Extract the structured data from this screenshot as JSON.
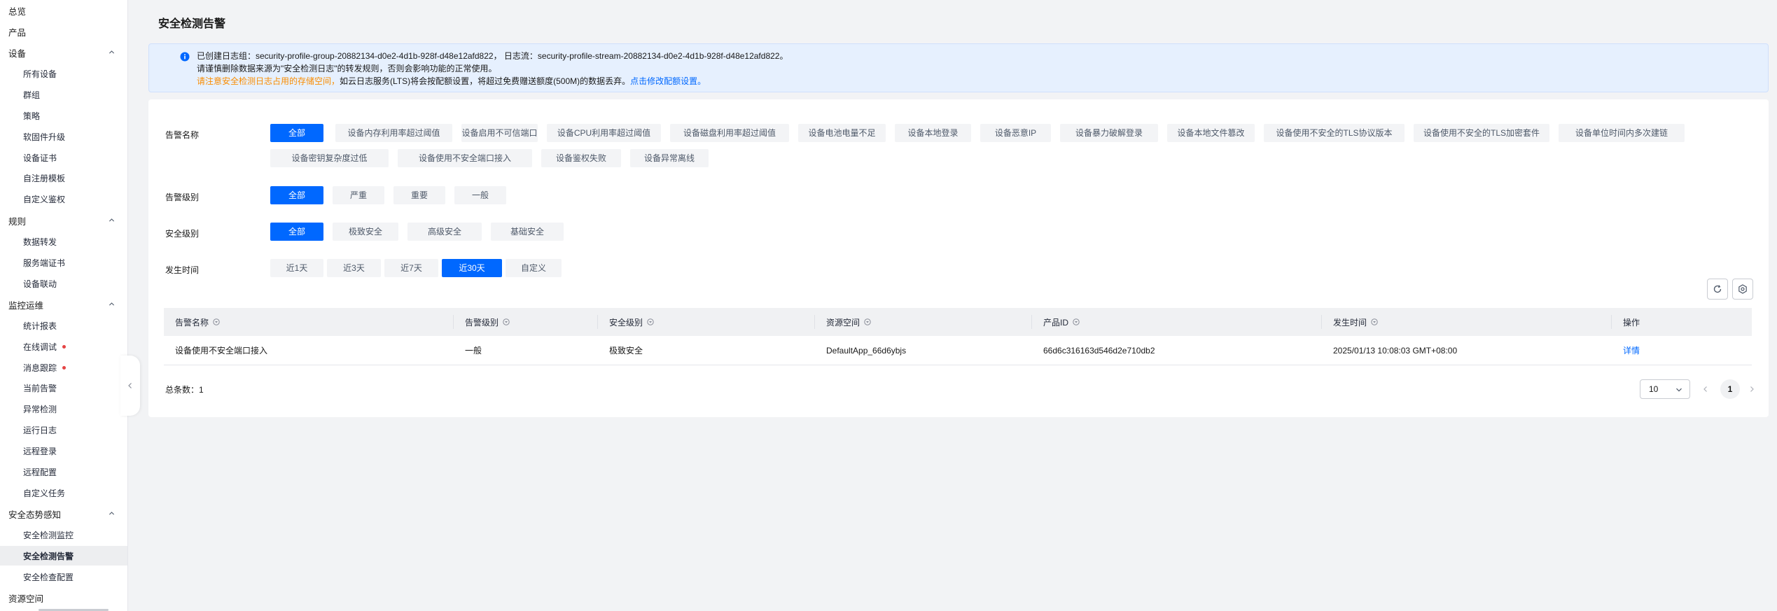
{
  "sidebar": {
    "items": [
      {
        "label": "总览",
        "level": "top"
      },
      {
        "label": "产品",
        "level": "top"
      },
      {
        "label": "设备",
        "level": "top",
        "expandable": true
      },
      {
        "label": "所有设备",
        "level": "sub"
      },
      {
        "label": "群组",
        "level": "sub"
      },
      {
        "label": "策略",
        "level": "sub"
      },
      {
        "label": "软固件升级",
        "level": "sub"
      },
      {
        "label": "设备证书",
        "level": "sub"
      },
      {
        "label": "自注册模板",
        "level": "sub"
      },
      {
        "label": "自定义鉴权",
        "level": "sub"
      },
      {
        "label": "规则",
        "level": "top",
        "expandable": true
      },
      {
        "label": "数据转发",
        "level": "sub"
      },
      {
        "label": "服务端证书",
        "level": "sub"
      },
      {
        "label": "设备联动",
        "level": "sub"
      },
      {
        "label": "监控运维",
        "level": "top",
        "expandable": true
      },
      {
        "label": "统计报表",
        "level": "sub"
      },
      {
        "label": "在线调试",
        "level": "sub",
        "dot": true
      },
      {
        "label": "消息跟踪",
        "level": "sub",
        "dot": true
      },
      {
        "label": "当前告警",
        "level": "sub"
      },
      {
        "label": "异常检测",
        "level": "sub"
      },
      {
        "label": "运行日志",
        "level": "sub"
      },
      {
        "label": "远程登录",
        "level": "sub"
      },
      {
        "label": "远程配置",
        "level": "sub"
      },
      {
        "label": "自定义任务",
        "level": "sub"
      },
      {
        "label": "安全态势感知",
        "level": "top",
        "expandable": true
      },
      {
        "label": "安全检测监控",
        "level": "sub"
      },
      {
        "label": "安全检测告警",
        "level": "sub",
        "active": true
      },
      {
        "label": "安全检查配置",
        "level": "sub"
      },
      {
        "label": "资源空间",
        "level": "top"
      }
    ]
  },
  "page": {
    "title": "安全检测告警"
  },
  "notice": {
    "line1": "已创建日志组：security-profile-group-20882134-d0e2-4d1b-928f-d48e12afd822，  日志流：security-profile-stream-20882134-d0e2-4d1b-928f-d48e12afd822。",
    "line2": "请谨慎删除数据来源为\"安全检测日志\"的转发规则，否则会影响功能的正常使用。",
    "line3_warn": "请注意安全检测日志占用的存储空间，",
    "line3_text": "如云日志服务(LTS)将会按配额设置，将超过免费赠送额度(500M)的数据丢弃。",
    "line3_link": "点击修改配额设置。"
  },
  "filters": {
    "alarm_name": {
      "label": "告警名称",
      "options": [
        "全部",
        "设备内存利用率超过阈值",
        "设备启用不可信端口",
        "设备CPU利用率超过阈值",
        "设备磁盘利用率超过阈值",
        "设备电池电量不足",
        "设备本地登录",
        "设备恶意IP",
        "设备暴力破解登录",
        "设备本地文件篡改",
        "设备使用不安全的TLS协议版本",
        "设备使用不安全的TLS加密套件",
        "设备单位时间内多次建链",
        "设备密钥复杂度过低",
        "设备使用不安全端口接入",
        "设备鉴权失败",
        "设备异常离线"
      ],
      "selected": 0
    },
    "alarm_level": {
      "label": "告警级别",
      "options": [
        "全部",
        "严重",
        "重要",
        "一般"
      ],
      "selected": 0
    },
    "security_level": {
      "label": "安全级别",
      "options": [
        "全部",
        "极致安全",
        "高级安全",
        "基础安全"
      ],
      "selected": 0
    },
    "time": {
      "label": "发生时间",
      "options": [
        "近1天",
        "近3天",
        "近7天",
        "近30天",
        "自定义"
      ],
      "selected": 3
    }
  },
  "table": {
    "columns": [
      "告警名称",
      "告警级别",
      "安全级别",
      "资源空间",
      "产品ID",
      "发生时间",
      "操作"
    ],
    "rows": [
      [
        "设备使用不安全端口接入",
        "一般",
        "极致安全",
        "DefaultApp_66d6ybjs",
        "66d6c316163d546d2e710db2",
        "2025/01/13 10:08:03 GMT+08:00",
        "详情"
      ]
    ]
  },
  "pagination": {
    "total_label": "总条数：",
    "total": "1",
    "page_size": "10",
    "current_page": "1"
  },
  "colors": {
    "primary": "#0068ff",
    "warning": "#f98c00",
    "notice_bg": "#e6f0fe",
    "dot": "#e54545"
  }
}
